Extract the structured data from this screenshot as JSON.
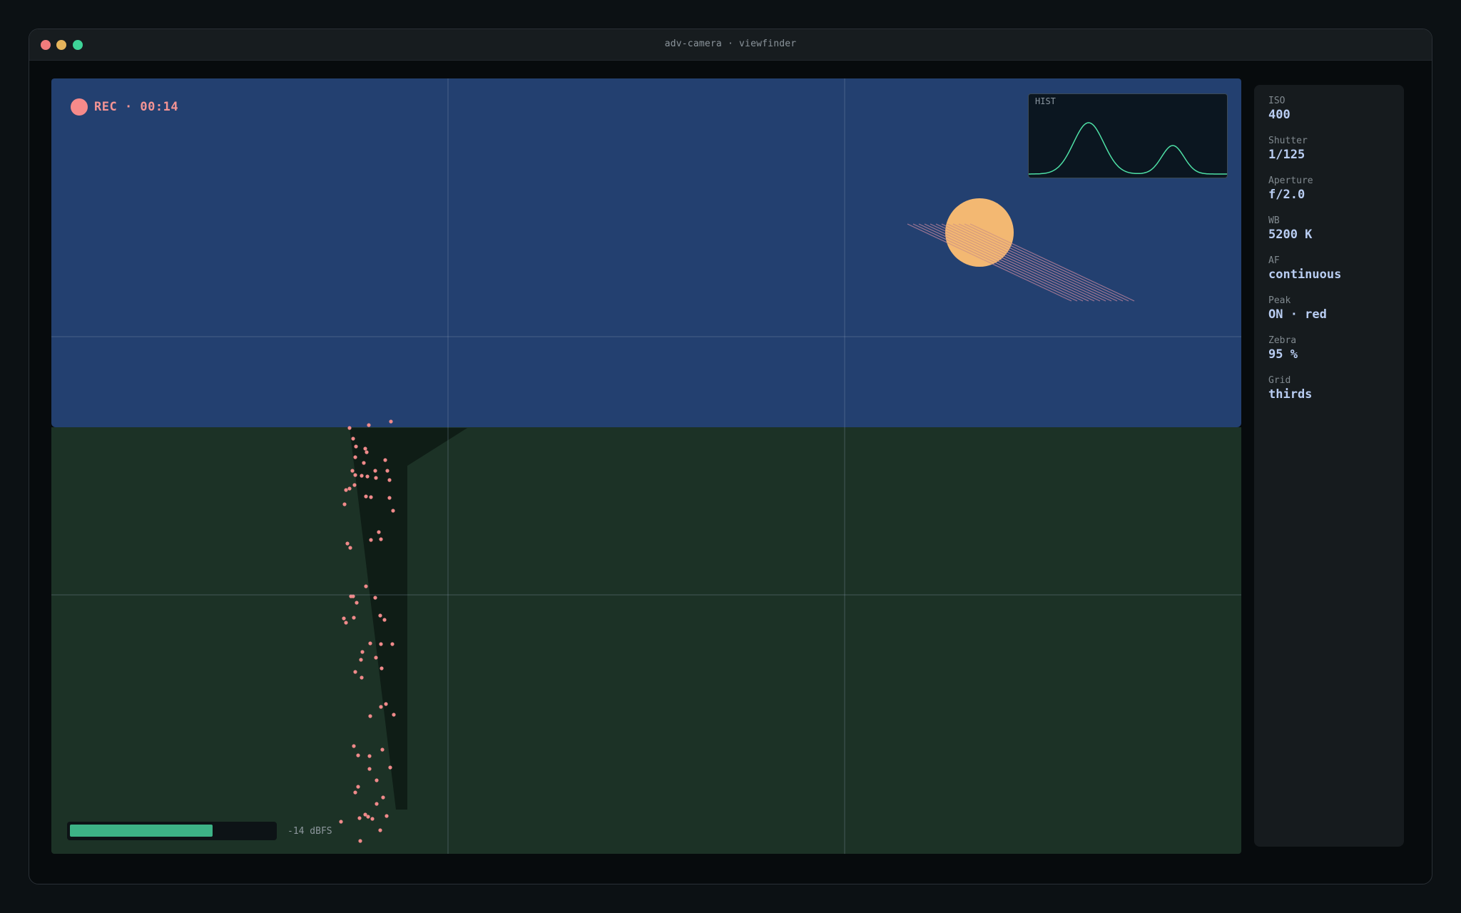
{
  "window": {
    "title": "adv-camera · viewfinder"
  },
  "recording": {
    "label": "REC · 00:14",
    "color": "#f58a8a"
  },
  "histogram": {
    "label": "HIST",
    "color": "#4ee0a6"
  },
  "audio": {
    "level_fraction": 0.7,
    "label": "-14 dBFS",
    "color": "#3db386"
  },
  "colors": {
    "sky": "#234070",
    "ground": "#1c3226",
    "sun": "#f3b872",
    "peaking": "#f08a8a"
  },
  "settings": [
    {
      "key": "ISO",
      "value": "400"
    },
    {
      "key": "Shutter",
      "value": "1/125"
    },
    {
      "key": "Aperture",
      "value": "f/2.0"
    },
    {
      "key": "WB",
      "value": "5200 K"
    },
    {
      "key": "AF",
      "value": "continuous"
    },
    {
      "key": "Peak",
      "value": "ON · red"
    },
    {
      "key": "Zebra",
      "value": "95 %"
    },
    {
      "key": "Grid",
      "value": "thirds"
    }
  ]
}
